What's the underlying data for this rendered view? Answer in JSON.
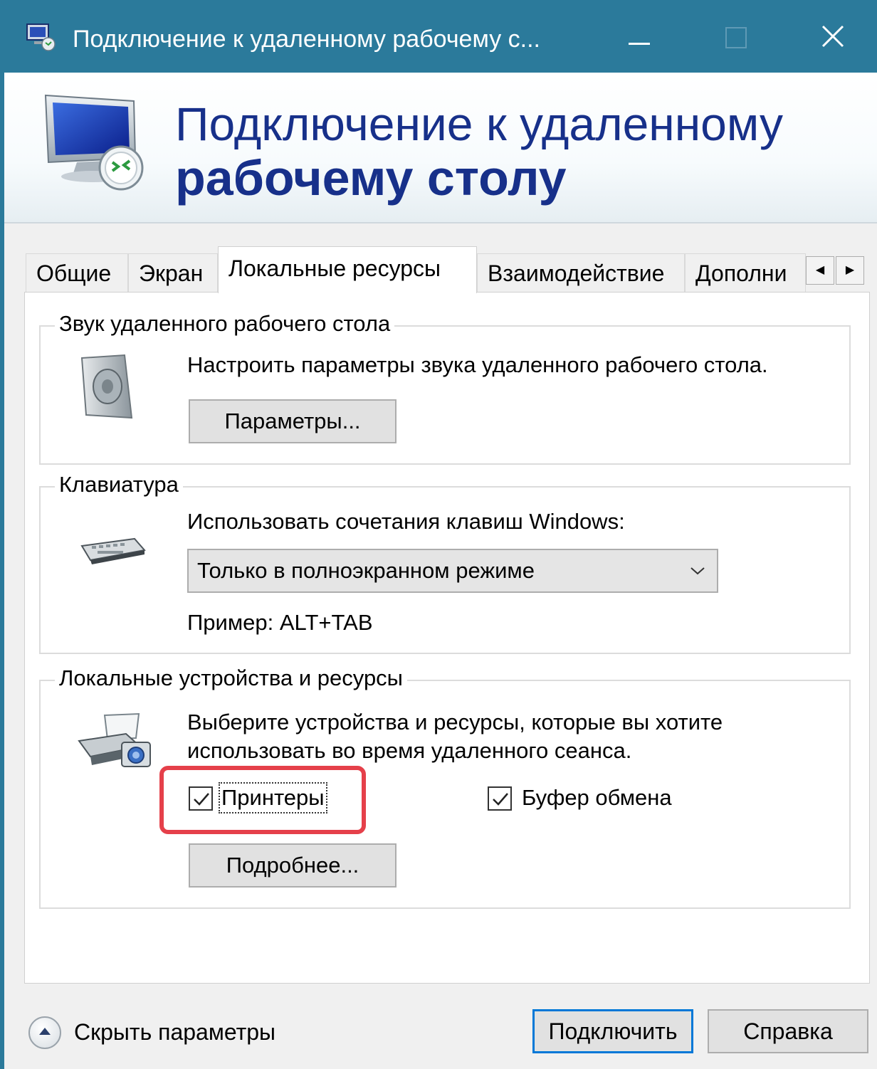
{
  "window": {
    "title": "Подключение к удаленному рабочему с...",
    "controls": {
      "minimize": "minimize",
      "maximize": "maximize",
      "close": "close"
    }
  },
  "banner": {
    "line1": "Подключение к удаленному",
    "line2": "рабочему столу"
  },
  "tabs": [
    {
      "label": "Общие",
      "active": false
    },
    {
      "label": "Экран",
      "active": false
    },
    {
      "label": "Локальные ресурсы",
      "active": true
    },
    {
      "label": "Взаимодействие",
      "active": false
    },
    {
      "label": "Дополни",
      "active": false
    }
  ],
  "audio": {
    "legend": "Звук удаленного рабочего стола",
    "description": "Настроить параметры звука удаленного рабочего стола.",
    "button": "Параметры..."
  },
  "keyboard": {
    "legend": "Клавиатура",
    "description": "Использовать сочетания клавиш Windows:",
    "selected": "Только в полноэкранном режиме",
    "example": "Пример: ALT+TAB"
  },
  "devices": {
    "legend": "Локальные устройства и ресурсы",
    "description_line1": "Выберите устройства и ресурсы, которые вы хотите",
    "description_line2": "использовать во время удаленного сеанса.",
    "printers_label": "Принтеры",
    "printers_checked": true,
    "clipboard_label": "Буфер обмена",
    "clipboard_checked": true,
    "more_button": "Подробнее..."
  },
  "footer": {
    "hide_options": "Скрыть параметры",
    "connect": "Подключить",
    "help": "Справка"
  },
  "colors": {
    "titlebar": "#2b7a9b",
    "banner_text": "#17308a",
    "highlight": "#e5404a",
    "focus_button_border": "#0078d7"
  }
}
